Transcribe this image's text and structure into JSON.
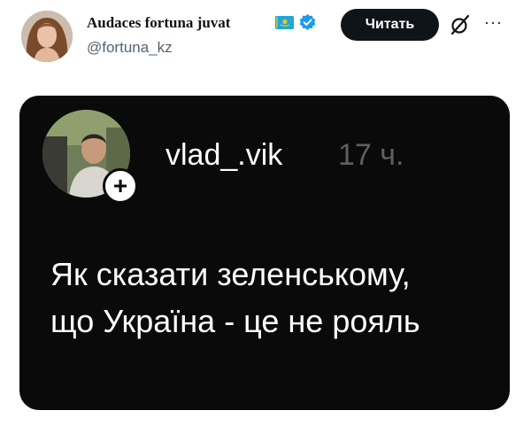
{
  "tweet": {
    "author_name": "Audaces fortuna juvat",
    "handle": "@fortuna_kz",
    "flag_icon": "kazakhstan-flag-icon",
    "verified_icon": "verified-badge-icon",
    "read_button_label": "Читать",
    "grok_icon": "grok-icon",
    "more_icon": "more-options-icon",
    "more_glyph": "···"
  },
  "card": {
    "username": "vlad_.vik",
    "time": "17 ч.",
    "follow_icon": "plus-icon",
    "follow_glyph": "+",
    "text_lines": [
      "Як сказати зеленському,",
      "що Україна - це не рояль"
    ]
  },
  "colors": {
    "card_background": "#0a0a0a",
    "verified_blue": "#1d9bf0",
    "flag_blue": "#22a7d8",
    "flag_gold": "#f5c518"
  }
}
